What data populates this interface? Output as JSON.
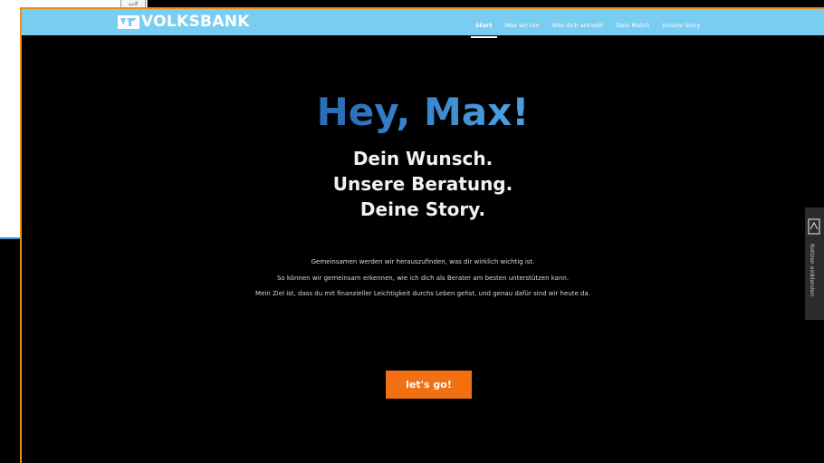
{
  "background_window": {
    "tab_label": "ت∂"
  },
  "navbar": {
    "brand": "VOLKSBANK",
    "items": [
      {
        "label": "Start",
        "active": true
      },
      {
        "label": "Was wir tun",
        "active": false
      },
      {
        "label": "Was dich antreibt",
        "active": false
      },
      {
        "label": "Dein Match",
        "active": false
      },
      {
        "label": "Unsere Story",
        "active": false
      }
    ]
  },
  "hero": {
    "greeting": "Hey, Max!",
    "headline_lines": [
      "Dein Wunsch.",
      "Unsere Beratung.",
      "Deine Story."
    ],
    "body_lines": [
      "Gemeinsamen werden wir herauszufinden, was dir wirklich wichtig ist.",
      "So können wir gemeinsam erkennen, wie ich dich als Berater am besten unterstützen kann.",
      "Mein Ziel ist, dass du mit finanzieller Leichtigkeit durchs Leben gehst, und genau dafür sind wir heute da."
    ],
    "cta_label": "let's go!"
  },
  "side_panel": {
    "label": "Notizen einblenden",
    "icon": "notes-icon"
  },
  "colors": {
    "navbar": "#79cdf0",
    "accent_orange": "#f26f12",
    "greeting_blue": "#2d7fc8",
    "frame_orange": "#f08a1c"
  }
}
